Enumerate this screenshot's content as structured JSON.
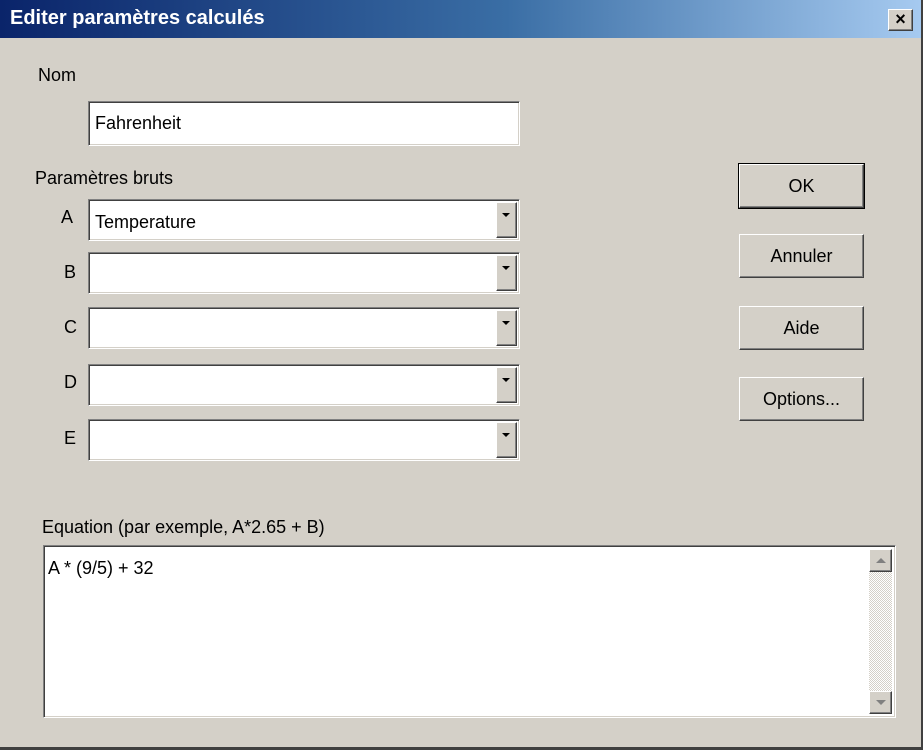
{
  "window": {
    "title": "Editer paramètres calculés",
    "close_glyph": "×",
    "titlebar_colors": [
      "#0a246a",
      "#a6caf0"
    ],
    "face_color": "#d4d0c8"
  },
  "name_section": {
    "label": "Nom",
    "value": "Fahrenheit"
  },
  "raw_params": {
    "label": "Paramètres bruts",
    "rows": [
      {
        "letter": "A",
        "value": "Temperature"
      },
      {
        "letter": "B",
        "value": ""
      },
      {
        "letter": "C",
        "value": ""
      },
      {
        "letter": "D",
        "value": ""
      },
      {
        "letter": "E",
        "value": ""
      }
    ]
  },
  "buttons": {
    "ok": "OK",
    "cancel": "Annuler",
    "help": "Aide",
    "options": "Options..."
  },
  "equation": {
    "label": "Equation (par exemple, A*2.65 + B)",
    "value": "A * (9/5) + 32"
  },
  "icons": {
    "dropdown": "chevron-down-icon",
    "scroll_up": "scroll-up-arrow-icon",
    "scroll_down": "scroll-down-arrow-icon",
    "close": "close-icon"
  }
}
